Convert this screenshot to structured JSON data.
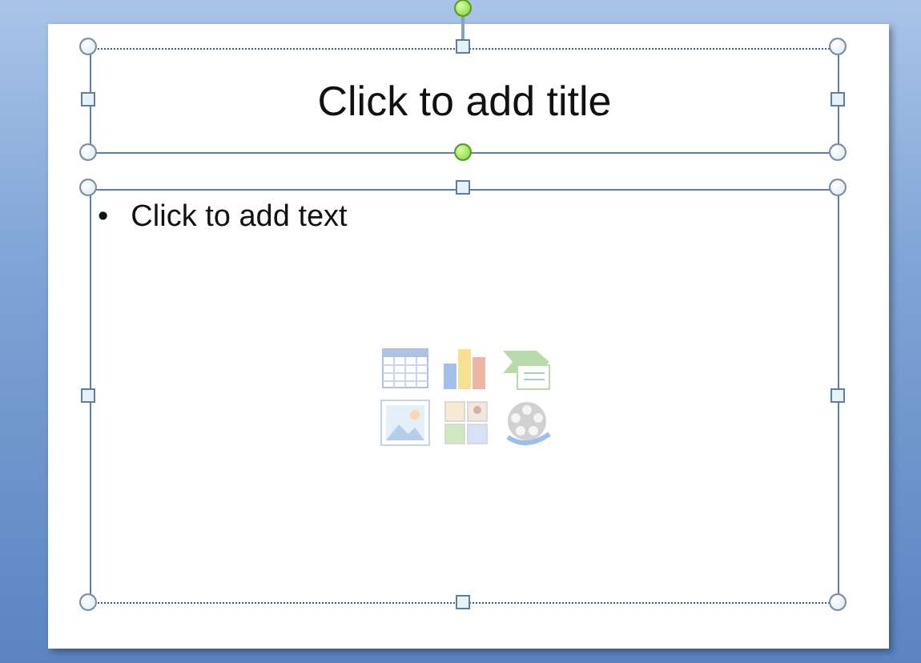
{
  "slide": {
    "title_placeholder": "Click to add title",
    "body_placeholder": {
      "bullet": "•",
      "text": "Click to add text"
    }
  }
}
